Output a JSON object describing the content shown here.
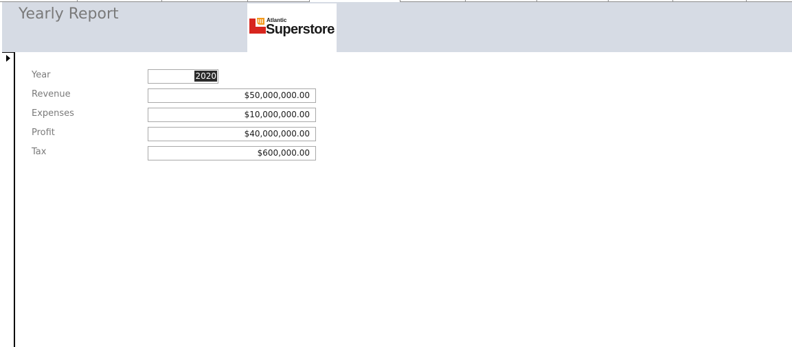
{
  "header": {
    "title": "Yearly Report"
  },
  "logo": {
    "small_text": "Atlantic",
    "big_text": "Superstore",
    "red_color": "#d7261e",
    "orange_color": "#f39a1e"
  },
  "form": {
    "year": {
      "label": "Year",
      "value": "2020"
    },
    "revenue": {
      "label": "Revenue",
      "value": "$50,000,000.00"
    },
    "expenses": {
      "label": "Expenses",
      "value": "$10,000,000.00"
    },
    "profit": {
      "label": "Profit",
      "value": "$40,000,000.00"
    },
    "tax": {
      "label": "Tax",
      "value": "$600,000.00"
    }
  },
  "colors": {
    "header_bg": "#d6dbe4",
    "label_text": "#7a7a7a",
    "selection_bg": "#2b2b2b"
  }
}
